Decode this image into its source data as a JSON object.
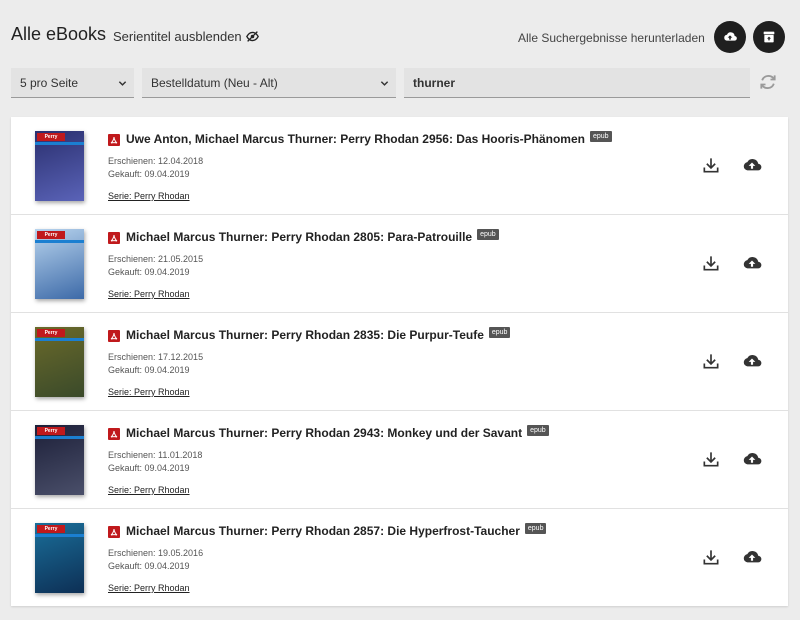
{
  "header": {
    "title": "Alle eBooks",
    "hide_series_label": "Serientitel ausblenden",
    "download_all_label": "Alle Suchergebnisse herunterladen"
  },
  "filters": {
    "per_page": "5 pro Seite",
    "sort": "Bestelldatum (Neu - Alt)",
    "search_value": "thurner"
  },
  "books": [
    {
      "title": "Uwe Anton, Michael Marcus Thurner:  Perry Rhodan 2956: Das Hooris-Phänomen",
      "format": "epub",
      "published": "Erschienen: 12.04.2018",
      "bought": "Gekauft: 09.04.2019",
      "series": "Serie: Perry Rhodan",
      "cover_colors": [
        "#2a2f6e",
        "#5a63b8"
      ]
    },
    {
      "title": "Michael Marcus Thurner:  Perry Rhodan 2805: Para-Patrouille",
      "format": "epub",
      "published": "Erschienen: 21.05.2015",
      "bought": "Gekauft: 09.04.2019",
      "series": "Serie: Perry Rhodan",
      "cover_colors": [
        "#b8d4ee",
        "#3d6aa8"
      ]
    },
    {
      "title": "Michael Marcus Thurner:  Perry Rhodan 2835: Die Purpur-Teufe",
      "format": "epub",
      "published": "Erschienen: 17.12.2015",
      "bought": "Gekauft: 09.04.2019",
      "series": "Serie: Perry Rhodan",
      "cover_colors": [
        "#6b6a2a",
        "#3a4a2a"
      ]
    },
    {
      "title": "Michael Marcus Thurner:  Perry Rhodan 2943: Monkey und der Savant",
      "format": "epub",
      "published": "Erschienen: 11.01.2018",
      "bought": "Gekauft: 09.04.2019",
      "series": "Serie: Perry Rhodan",
      "cover_colors": [
        "#1c1f38",
        "#4a4f6a"
      ]
    },
    {
      "title": "Michael Marcus Thurner:  Perry Rhodan 2857: Die Hyperfrost-Taucher",
      "format": "epub",
      "published": "Erschienen: 19.05.2016",
      "bought": "Gekauft: 09.04.2019",
      "series": "Serie: Perry Rhodan",
      "cover_colors": [
        "#1a6f9a",
        "#0d2f55"
      ]
    }
  ],
  "colors": {
    "accent_red": "#c0191c",
    "dark_button": "#1f1f1f",
    "badge_bg": "#555555"
  },
  "icons": {
    "hide_series": "eye-slash-icon",
    "cloud_upload": "cloud-upload-icon",
    "archive": "archive-icon",
    "refresh": "refresh-icon",
    "pdf": "pdf-icon",
    "download": "download-icon"
  }
}
